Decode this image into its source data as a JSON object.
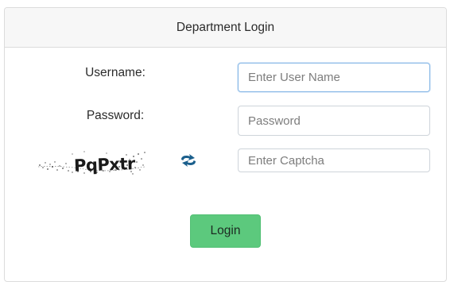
{
  "header": {
    "title": "Department Login"
  },
  "form": {
    "username_label": "Username:",
    "username_placeholder": "Enter User Name",
    "password_label": "Password:",
    "password_placeholder": "Password",
    "captcha_text": "PqPxtr",
    "captcha_placeholder": "Enter Captcha",
    "login_label": "Login"
  },
  "icons": {
    "refresh": "refresh-captcha-icon"
  },
  "colors": {
    "login_button": "#5cc97d",
    "refresh_icon": "#1b5f8c",
    "focus_border": "#86b7e6"
  }
}
